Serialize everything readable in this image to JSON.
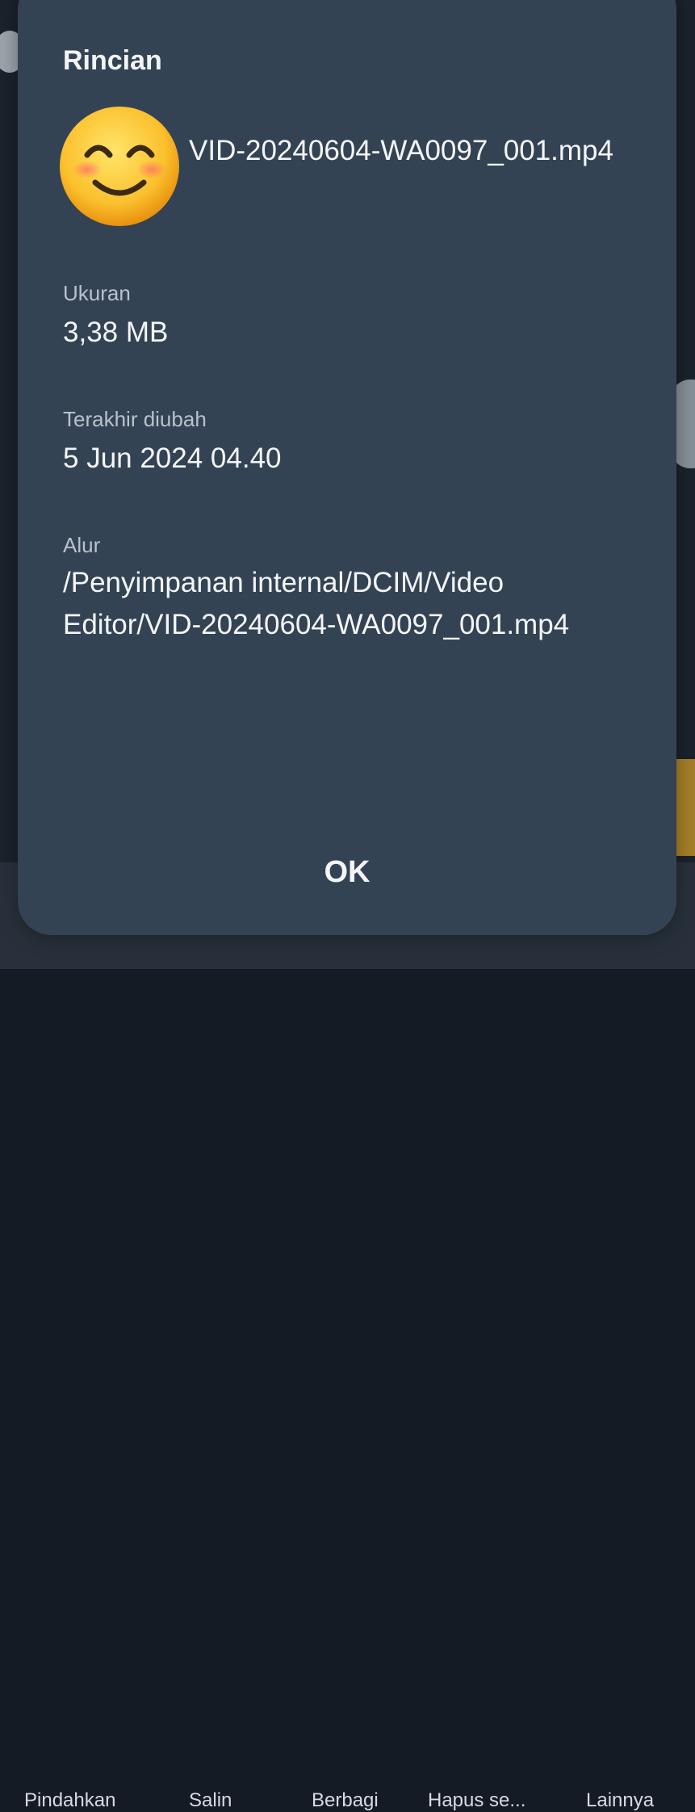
{
  "dialog": {
    "title": "Rincian",
    "thumbnail_icon": "smiling-face-emoji",
    "file_name": "VID-20240604-WA0097_001.mp4",
    "size": {
      "label": "Ukuran",
      "value": "3,38 MB"
    },
    "modified": {
      "label": "Terakhir diubah",
      "value": "5 Jun 2024 04.40"
    },
    "path": {
      "label": "Alur",
      "value": "/Penyimpanan internal/DCIM/Video Editor/VID-20240604-WA0097_001.mp4"
    },
    "ok_label": "OK"
  },
  "background_toolbar": {
    "items": [
      "Pindahkan",
      "Salin",
      "Berbagi",
      "Hapus se...",
      "Lainnya"
    ]
  },
  "colors": {
    "dialog_bg": "#344353",
    "text_primary": "#f3f5f8",
    "text_secondary": "#b8c2cd"
  }
}
